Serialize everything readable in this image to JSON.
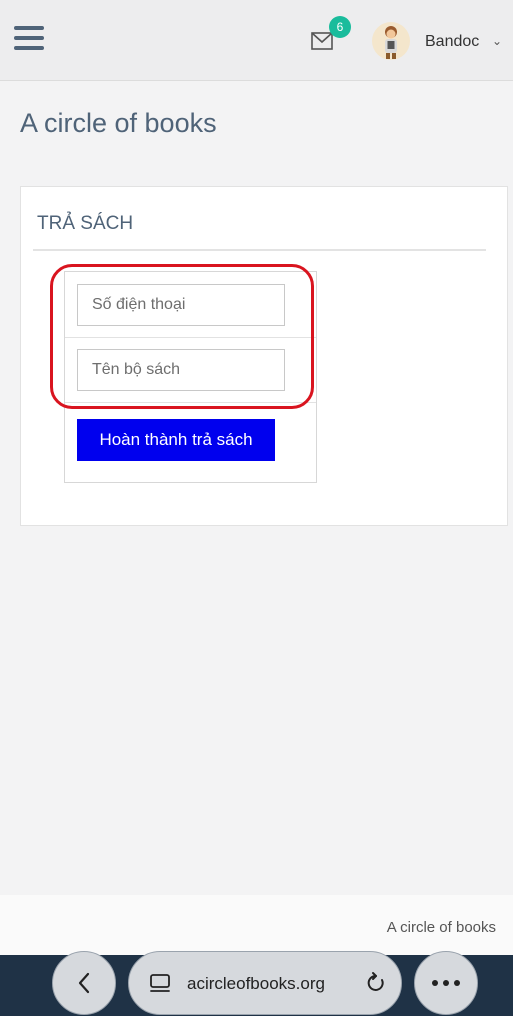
{
  "header": {
    "notification_count": "6",
    "user_name": "Bandoc",
    "user_menu_chevron": "⌄",
    "icons": [
      "menu-icon",
      "mail-icon",
      "avatar",
      "chevron-down-icon"
    ],
    "badge_color": "#1abc9c"
  },
  "page": {
    "title": "A circle of books"
  },
  "panel": {
    "title": "TRẢ SÁCH",
    "fields": {
      "phone_placeholder": "Số điện thoại",
      "phone_value": "",
      "book_set_placeholder": "Tên bộ sách",
      "book_set_value": ""
    },
    "submit_label": "Hoàn thành trả sách",
    "submit_color": "#0000ee",
    "highlight_color": "#d9141f"
  },
  "footer": {
    "text": "A circle of books"
  },
  "browser": {
    "url": "acircleofbooks.org",
    "icons": [
      "back-icon",
      "tab-icon",
      "reload-icon",
      "more-icon"
    ]
  }
}
